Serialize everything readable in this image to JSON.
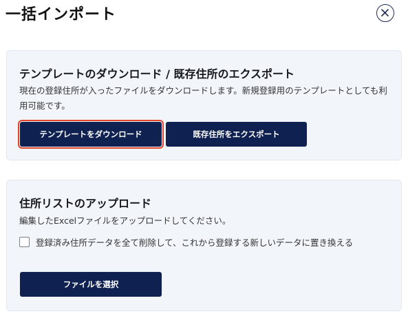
{
  "dialog": {
    "title": "一括インポート",
    "close_icon": "close-icon"
  },
  "download_section": {
    "title": "テンプレートのダウンロード / 既存住所のエクスポート",
    "description": "現在の登録住所が入ったファイルをダウンロードします。新規登録用のテンプレートとしても利用可能です。",
    "template_button_label": "テンプレートをダウンロード",
    "export_button_label": "既存住所をエクスポート"
  },
  "upload_section": {
    "title": "住所リストのアップロード",
    "description": "編集したExcelファイルをアップロードしてください。",
    "replace_checkbox_label": "登録済み住所データを全て削除して、これから登録する新しいデータに置き換える",
    "replace_checked": false,
    "select_file_button_label": "ファイルを選択"
  },
  "colors": {
    "primary_button": "#0f2150",
    "card_background": "#f2f6fb",
    "highlight_outline": "#e0442c"
  }
}
